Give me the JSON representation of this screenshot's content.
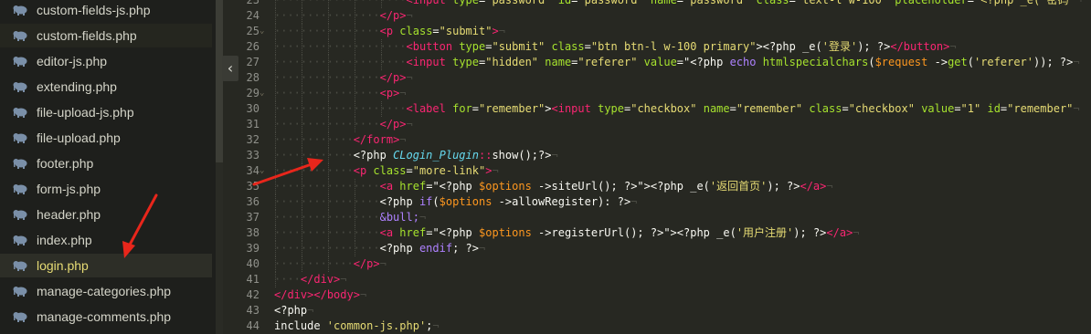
{
  "sidebar": {
    "files": [
      {
        "name": "custom-fields-js.php",
        "state": "normal"
      },
      {
        "name": "custom-fields.php",
        "state": "dark"
      },
      {
        "name": "editor-js.php",
        "state": "normal"
      },
      {
        "name": "extending.php",
        "state": "normal"
      },
      {
        "name": "file-upload-js.php",
        "state": "normal"
      },
      {
        "name": "file-upload.php",
        "state": "normal"
      },
      {
        "name": "footer.php",
        "state": "normal"
      },
      {
        "name": "form-js.php",
        "state": "normal"
      },
      {
        "name": "header.php",
        "state": "normal"
      },
      {
        "name": "index.php",
        "state": "normal"
      },
      {
        "name": "login.php",
        "state": "active"
      },
      {
        "name": "manage-categories.php",
        "state": "normal"
      },
      {
        "name": "manage-comments.php",
        "state": "normal"
      }
    ],
    "file_icon": "elephant-php-icon",
    "collapse_icon": "chevron-left-icon",
    "collapse_glyph": "‹"
  },
  "editor": {
    "lines": [
      {
        "n": "23",
        "fold": false,
        "indent": 5,
        "tokens": [
          [
            "<",
            "t"
          ],
          [
            "input",
            "t"
          ],
          [
            " ",
            ""
          ],
          [
            "type",
            "a"
          ],
          [
            "=",
            ""
          ],
          [
            "\"password\"",
            "s"
          ],
          [
            " ",
            ""
          ],
          [
            "id",
            "a"
          ],
          [
            "=",
            ""
          ],
          [
            "\"password\"",
            "s"
          ],
          [
            " ",
            ""
          ],
          [
            "name",
            "a"
          ],
          [
            "=",
            ""
          ],
          [
            "\"password\"",
            "s"
          ],
          [
            " ",
            ""
          ],
          [
            "class",
            "a"
          ],
          [
            "=",
            ""
          ],
          [
            "\"text-l w-100\"",
            "s"
          ],
          [
            " ",
            ""
          ],
          [
            "placeholder",
            "a"
          ],
          [
            "=",
            ""
          ],
          [
            "\"<?php _e('密码'",
            "s"
          ]
        ]
      },
      {
        "n": "24",
        "fold": false,
        "indent": 4,
        "tokens": [
          [
            "</",
            "t"
          ],
          [
            "p",
            "t"
          ],
          [
            ">",
            "t"
          ]
        ]
      },
      {
        "n": "25",
        "fold": true,
        "indent": 4,
        "tokens": [
          [
            "<",
            "t"
          ],
          [
            "p",
            "t"
          ],
          [
            " ",
            ""
          ],
          [
            "class",
            "a"
          ],
          [
            "=",
            ""
          ],
          [
            "\"submit\"",
            "s"
          ],
          [
            ">",
            "t"
          ]
        ]
      },
      {
        "n": "26",
        "fold": false,
        "indent": 5,
        "tokens": [
          [
            "<",
            "t"
          ],
          [
            "button",
            "t"
          ],
          [
            " ",
            ""
          ],
          [
            "type",
            "a"
          ],
          [
            "=",
            ""
          ],
          [
            "\"submit\"",
            "s"
          ],
          [
            " ",
            ""
          ],
          [
            "class",
            "a"
          ],
          [
            "=",
            ""
          ],
          [
            "\"btn btn-l w-100 primary\"",
            "s"
          ],
          [
            ">",
            ""
          ],
          [
            "<?php",
            ""
          ],
          [
            " _e(",
            ""
          ],
          [
            "'登录'",
            "s"
          ],
          [
            ");",
            ""
          ],
          [
            " ?>",
            ""
          ],
          [
            "</button>",
            "t"
          ]
        ]
      },
      {
        "n": "27",
        "fold": false,
        "indent": 5,
        "tokens": [
          [
            "<",
            "t"
          ],
          [
            "input",
            "t"
          ],
          [
            " ",
            ""
          ],
          [
            "type",
            "a"
          ],
          [
            "=",
            ""
          ],
          [
            "\"hidden\"",
            "s"
          ],
          [
            " ",
            ""
          ],
          [
            "name",
            "a"
          ],
          [
            "=",
            ""
          ],
          [
            "\"referer\"",
            "s"
          ],
          [
            " ",
            ""
          ],
          [
            "value",
            "a"
          ],
          [
            "=",
            ""
          ],
          [
            "\"<?php ",
            ""
          ],
          [
            "echo",
            "k"
          ],
          [
            " ",
            ""
          ],
          [
            "htmlspecialchars",
            "f"
          ],
          [
            "(",
            ""
          ],
          [
            "$request",
            "v"
          ],
          [
            " ->",
            ""
          ],
          [
            "get",
            "f"
          ],
          [
            "(",
            ""
          ],
          [
            "'referer'",
            "s"
          ],
          [
            "));",
            ""
          ],
          [
            " ?>",
            ""
          ]
        ]
      },
      {
        "n": "28",
        "fold": false,
        "indent": 4,
        "tokens": [
          [
            "</",
            "t"
          ],
          [
            "p",
            "t"
          ],
          [
            ">",
            "t"
          ]
        ]
      },
      {
        "n": "29",
        "fold": true,
        "indent": 4,
        "tokens": [
          [
            "<",
            "t"
          ],
          [
            "p",
            "t"
          ],
          [
            ">",
            "t"
          ]
        ]
      },
      {
        "n": "30",
        "fold": false,
        "indent": 5,
        "tokens": [
          [
            "<",
            "t"
          ],
          [
            "label",
            "t"
          ],
          [
            " ",
            ""
          ],
          [
            "for",
            "a"
          ],
          [
            "=",
            ""
          ],
          [
            "\"remember\"",
            "s"
          ],
          [
            ">",
            ""
          ],
          [
            "<",
            "t"
          ],
          [
            "input",
            "t"
          ],
          [
            " ",
            ""
          ],
          [
            "type",
            "a"
          ],
          [
            "=",
            ""
          ],
          [
            "\"checkbox\"",
            "s"
          ],
          [
            " ",
            ""
          ],
          [
            "name",
            "a"
          ],
          [
            "=",
            ""
          ],
          [
            "\"remember\"",
            "s"
          ],
          [
            " ",
            ""
          ],
          [
            "class",
            "a"
          ],
          [
            "=",
            ""
          ],
          [
            "\"checkbox\"",
            "s"
          ],
          [
            " ",
            ""
          ],
          [
            "value",
            "a"
          ],
          [
            "=",
            ""
          ],
          [
            "\"1\"",
            "s"
          ],
          [
            " ",
            ""
          ],
          [
            "id",
            "a"
          ],
          [
            "=",
            ""
          ],
          [
            "\"remember\"",
            "s"
          ]
        ]
      },
      {
        "n": "31",
        "fold": false,
        "indent": 4,
        "tokens": [
          [
            "</",
            "t"
          ],
          [
            "p",
            "t"
          ],
          [
            ">",
            "t"
          ]
        ]
      },
      {
        "n": "32",
        "fold": false,
        "indent": 3,
        "tokens": [
          [
            "</",
            "t"
          ],
          [
            "form",
            "t"
          ],
          [
            ">",
            "t"
          ]
        ]
      },
      {
        "n": "33",
        "fold": false,
        "indent": 3,
        "tokens": [
          [
            "<?php ",
            ""
          ],
          [
            "CLogin_Plugin",
            "c"
          ],
          [
            "::",
            "t"
          ],
          [
            "show",
            ""
          ],
          [
            "();?>",
            ""
          ]
        ]
      },
      {
        "n": "34",
        "fold": true,
        "indent": 3,
        "tokens": [
          [
            "<",
            "t"
          ],
          [
            "p",
            "t"
          ],
          [
            " ",
            ""
          ],
          [
            "class",
            "a"
          ],
          [
            "=",
            ""
          ],
          [
            "\"more-link\"",
            "s"
          ],
          [
            ">",
            "t"
          ]
        ]
      },
      {
        "n": "35",
        "fold": false,
        "indent": 4,
        "tokens": [
          [
            "<",
            "t"
          ],
          [
            "a",
            "t"
          ],
          [
            " ",
            ""
          ],
          [
            "href",
            "a"
          ],
          [
            "=",
            ""
          ],
          [
            "\"<?php ",
            ""
          ],
          [
            "$options",
            "v"
          ],
          [
            " ->",
            ""
          ],
          [
            "siteUrl",
            ""
          ],
          [
            "(); ?>\">",
            ""
          ],
          [
            "<?php _e(",
            ""
          ],
          [
            "'返回首页'",
            "s"
          ],
          [
            "); ?>",
            ""
          ],
          [
            "</a>",
            "t"
          ]
        ]
      },
      {
        "n": "36",
        "fold": false,
        "indent": 4,
        "tokens": [
          [
            "<?php ",
            ""
          ],
          [
            "if",
            "k"
          ],
          [
            "(",
            ""
          ],
          [
            "$options",
            "v"
          ],
          [
            " ->",
            ""
          ],
          [
            "allowRegister",
            ""
          ],
          [
            "): ?>",
            ""
          ]
        ]
      },
      {
        "n": "37",
        "fold": false,
        "indent": 4,
        "tokens": [
          [
            "&bull;",
            "k"
          ]
        ]
      },
      {
        "n": "38",
        "fold": false,
        "indent": 4,
        "tokens": [
          [
            "<",
            "t"
          ],
          [
            "a",
            "t"
          ],
          [
            " ",
            ""
          ],
          [
            "href",
            "a"
          ],
          [
            "=",
            ""
          ],
          [
            "\"<?php ",
            ""
          ],
          [
            "$options",
            "v"
          ],
          [
            " ->",
            ""
          ],
          [
            "registerUrl",
            ""
          ],
          [
            "(); ?>\">",
            ""
          ],
          [
            "<?php _e(",
            ""
          ],
          [
            "'用户注册'",
            "s"
          ],
          [
            "); ?>",
            ""
          ],
          [
            "</a>",
            "t"
          ]
        ]
      },
      {
        "n": "39",
        "fold": false,
        "indent": 4,
        "tokens": [
          [
            "<?php ",
            ""
          ],
          [
            "endif",
            "k"
          ],
          [
            "; ?>",
            ""
          ]
        ]
      },
      {
        "n": "40",
        "fold": false,
        "indent": 3,
        "tokens": [
          [
            "</",
            "t"
          ],
          [
            "p",
            "t"
          ],
          [
            ">",
            "t"
          ]
        ]
      },
      {
        "n": "41",
        "fold": false,
        "indent": 1,
        "tokens": [
          [
            "</",
            "t"
          ],
          [
            "div",
            "t"
          ],
          [
            ">",
            "t"
          ]
        ]
      },
      {
        "n": "42",
        "fold": false,
        "indent": 0,
        "tokens": [
          [
            "</",
            "t"
          ],
          [
            "div",
            "t"
          ],
          [
            "></",
            "t"
          ],
          [
            "body",
            "t"
          ],
          [
            ">",
            "t"
          ]
        ]
      },
      {
        "n": "43",
        "fold": false,
        "indent": 0,
        "tokens": [
          [
            "<?php",
            ""
          ]
        ]
      },
      {
        "n": "44",
        "fold": false,
        "indent": 0,
        "tokens": [
          [
            "include ",
            ""
          ],
          [
            "'common-js.php'",
            "s"
          ],
          [
            ";",
            ""
          ]
        ]
      }
    ],
    "colors": {
      "t": "#f92672",
      "a": "#a6e22e",
      "s": "#e6db74",
      "v": "#fd971f",
      "f": "#a6e22e",
      "k": "#ae81ff",
      "c": "#66d9ef",
      "": "#f8f8f2"
    },
    "fold_glyph": "⌄",
    "eol_glyph": "¬"
  },
  "annotations": {
    "arrow_color": "#e8261b"
  }
}
